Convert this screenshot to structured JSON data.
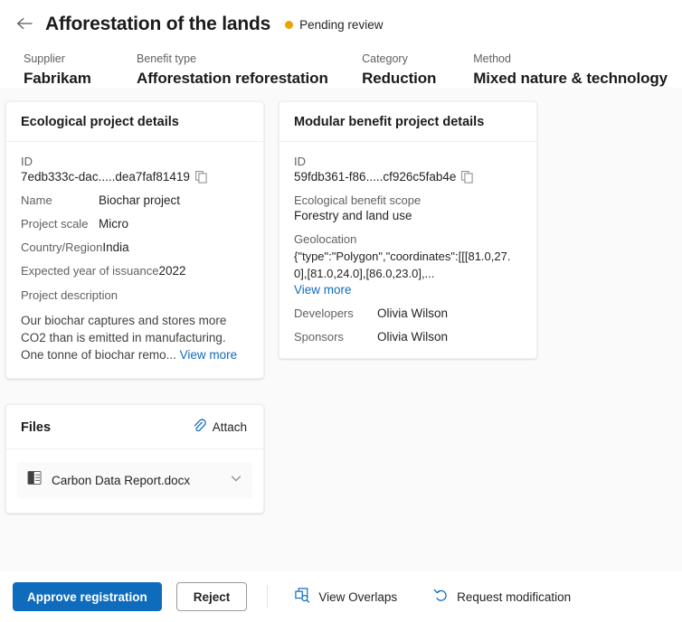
{
  "header": {
    "back_icon": "back-arrow-icon",
    "title": "Afforestation of the lands",
    "status": {
      "label": "Pending review",
      "color": "#eaa300"
    }
  },
  "meta": [
    {
      "label": "Supplier",
      "value": "Fabrikam"
    },
    {
      "label": "Benefit type",
      "value": "Afforestation reforestation"
    },
    {
      "label": "Category",
      "value": "Reduction"
    },
    {
      "label": "Method",
      "value": "Mixed nature & technology"
    }
  ],
  "ecological_card": {
    "title": "Ecological project details",
    "id_label": "ID",
    "id_value": "7edb333c-dac.....dea7faf81419",
    "copy_icon": "copy-icon",
    "name_label": "Name",
    "name_value": "Biochar project",
    "scale_label": "Project scale",
    "scale_value": "Micro",
    "country_label": "Country/Region",
    "country_value": "India",
    "issuance_label": "Expected year of issuance",
    "issuance_value": "2022",
    "description_label": "Project description",
    "description_value": "Our biochar captures and stores more CO2 than is emitted in manufacturing. One tonne of biochar remo...",
    "view_more": "View more"
  },
  "modular_card": {
    "title": "Modular benefit project details",
    "id_label": "ID",
    "id_value": "59fdb361-f86.....cf926c5fab4e",
    "copy_icon": "copy-icon",
    "scope_label": "Ecological benefit scope",
    "scope_value": "Forestry and land use",
    "geolocation_label": "Geolocation",
    "geolocation_value": "{\"type\":\"Polygon\",\"coordinates\":[[[81.0,27.0],[81.0,24.0],[86.0,23.0],...",
    "view_more": "View more",
    "developers_label": "Developers",
    "developers_value": "Olivia Wilson",
    "sponsors_label": "Sponsors",
    "sponsors_value": "Olivia Wilson"
  },
  "files_card": {
    "title": "Files",
    "attach_label": "Attach",
    "attach_icon": "paperclip-icon",
    "file_icon": "word-document-icon",
    "file_name": "Carbon Data Report.docx",
    "chevron_icon": "chevron-down-icon"
  },
  "footer": {
    "approve_label": "Approve registration",
    "reject_label": "Reject",
    "view_overlaps_label": "View Overlaps",
    "view_overlaps_icon": "overlap-search-icon",
    "request_modification_label": "Request modification",
    "request_modification_icon": "undo-arrow-icon"
  }
}
